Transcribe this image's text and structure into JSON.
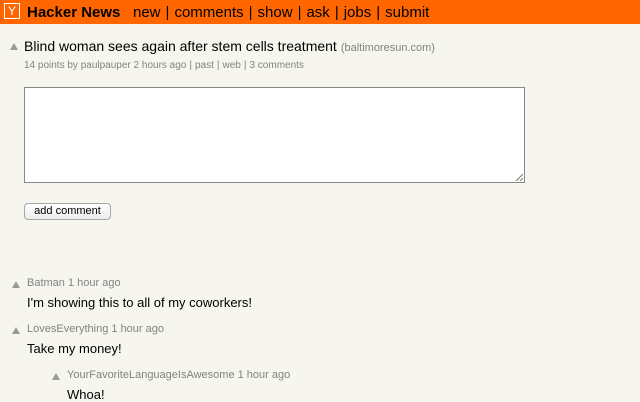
{
  "header": {
    "logo_letter": "Y",
    "site_title": "Hacker News",
    "nav": [
      "new",
      "comments",
      "show",
      "ask",
      "jobs",
      "submit"
    ],
    "separator": "|",
    "background_color": "#ff6600"
  },
  "story": {
    "title": "Blind woman sees again after stem cells treatment",
    "site": "(baltimoresun.com)",
    "points": "14 points",
    "by_label": "by",
    "author": "paulpauper",
    "age": "2 hours ago",
    "past_label": "past",
    "web_label": "web",
    "comments_label": "3 comments"
  },
  "reply": {
    "value": "",
    "button_label": "add comment"
  },
  "comments": [
    {
      "user": "Batman",
      "age": "1 hour ago",
      "text": "I'm showing this to all of my coworkers!"
    },
    {
      "user": "LovesEverything",
      "age": "1 hour ago",
      "text": "Take my money!"
    },
    {
      "user": "YourFavoriteLanguageIsAwesome",
      "age": "1 hour ago",
      "text": "Whoa!"
    }
  ],
  "colors": {
    "background": "#f6f6ef",
    "subtext": "#828282",
    "vote_arrow": "#9a9a9a"
  }
}
